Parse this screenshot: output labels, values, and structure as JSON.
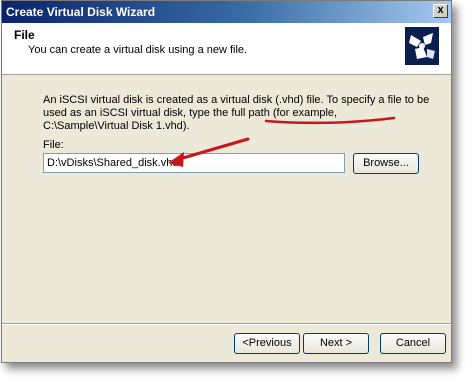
{
  "window": {
    "title": "Create Virtual Disk Wizard",
    "close_glyph": "x"
  },
  "header": {
    "title": "File",
    "subtitle": "You can create a virtual disk using a new file.",
    "icon": "wizard-disk-icon"
  },
  "body": {
    "description_part1": "An iSCSI virtual disk is created as a virtual disk (.vhd) file. To specify a file to be used as an iSCSI virtual disk, type the full path (for example, ",
    "example_path": "C:\\Sample\\Virtual Disk 1.vhd",
    "description_part2": ").",
    "file_label": "File:",
    "file_value": "D:\\vDisks\\Shared_disk.vhd",
    "browse_label": "Browse..."
  },
  "footer": {
    "previous_label": "<Previous",
    "next_label": "Next >",
    "cancel_label": "Cancel"
  },
  "annotations": {
    "arrow_color": "#c8161d",
    "underline_color": "#c8161d"
  }
}
